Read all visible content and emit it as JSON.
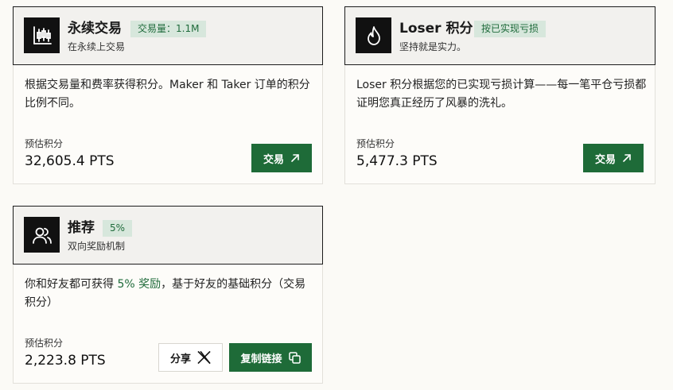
{
  "cards": {
    "trading": {
      "title": "永续交易",
      "badge": "交易量：1.1M",
      "subtitle": "在永续上交易",
      "description": "根据交易量和费率获得积分。Maker 和 Taker 订单的积分比例不同。",
      "estimate_label": "预估积分",
      "estimate_value": "32,605.4 PTS",
      "action_label": "交易",
      "icon": "candlestick-chart-icon"
    },
    "loser": {
      "title": "Loser 积分",
      "badge": "按已实现亏损",
      "subtitle": "坚持就是实力。",
      "description": "Loser 积分根据您的已实现亏损计算——每一笔平仓亏损都证明您真正经历了风暴的洗礼。",
      "estimate_label": "预估积分",
      "estimate_value": "5,477.3 PTS",
      "action_label": "交易",
      "icon": "flame-icon"
    },
    "referral": {
      "title": "推荐",
      "badge": "5%",
      "subtitle": "双向奖励机制",
      "description_prefix": "你和好友都可获得 ",
      "description_highlight": "5% 奖励",
      "description_suffix": "，基于好友的基础积分（交易积分）",
      "estimate_label": "预估积分",
      "estimate_value": "2,223.8 PTS",
      "share_label": "分享",
      "copy_label": "复制链接",
      "icon": "users-icon"
    }
  },
  "colors": {
    "accent": "#1e6b38",
    "badge_bg": "#d7e7dc",
    "badge_text": "#1f6b3b",
    "header_bg": "#f2f1ee",
    "page_bg": "#fbfaf6"
  }
}
